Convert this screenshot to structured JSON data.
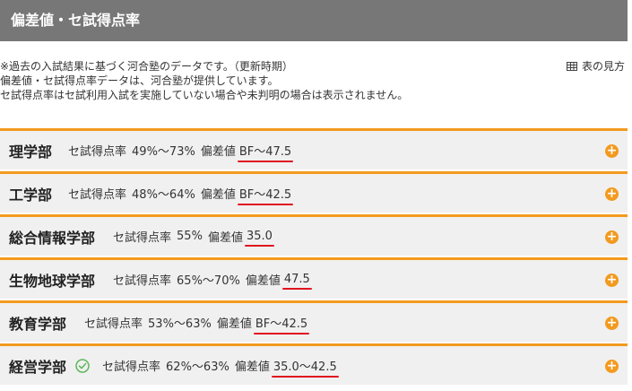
{
  "header": {
    "title": "偏差値・セ試得点率"
  },
  "notes": {
    "line1": "※過去の入試結果に基づく河合塾のデータです。（更新時期）",
    "line2": "偏差値・セ試得点率データは、河合塾が提供しています。",
    "line3": "セ試得点率はセ試利用入試を実施していない場合や未判明の場合は表示されません。"
  },
  "howto": {
    "label": "表の見方",
    "icon": "table-icon"
  },
  "colors": {
    "accent": "#f39a1e",
    "header_bg": "#777777",
    "underline": "#e0131f",
    "check": "#5cb85c"
  },
  "faculties": [
    {
      "name": "理学部",
      "score_label": "セ試得点率",
      "score": "49%〜73%",
      "dev_label": "偏差値",
      "dev": "BF〜47.5",
      "checked": false
    },
    {
      "name": "工学部",
      "score_label": "セ試得点率",
      "score": "48%〜64%",
      "dev_label": "偏差値",
      "dev": "BF〜42.5",
      "checked": false
    },
    {
      "name": "総合情報学部",
      "score_label": "セ試得点率",
      "score": "55%",
      "dev_label": "偏差値",
      "dev": "35.0",
      "checked": false
    },
    {
      "name": "生物地球学部",
      "score_label": "セ試得点率",
      "score": "65%〜70%",
      "dev_label": "偏差値",
      "dev": "47.5",
      "checked": false
    },
    {
      "name": "教育学部",
      "score_label": "セ試得点率",
      "score": "53%〜63%",
      "dev_label": "偏差値",
      "dev": "BF〜42.5",
      "checked": false
    },
    {
      "name": "経営学部",
      "score_label": "セ試得点率",
      "score": "62%〜63%",
      "dev_label": "偏差値",
      "dev": "35.0〜42.5",
      "checked": true
    }
  ]
}
